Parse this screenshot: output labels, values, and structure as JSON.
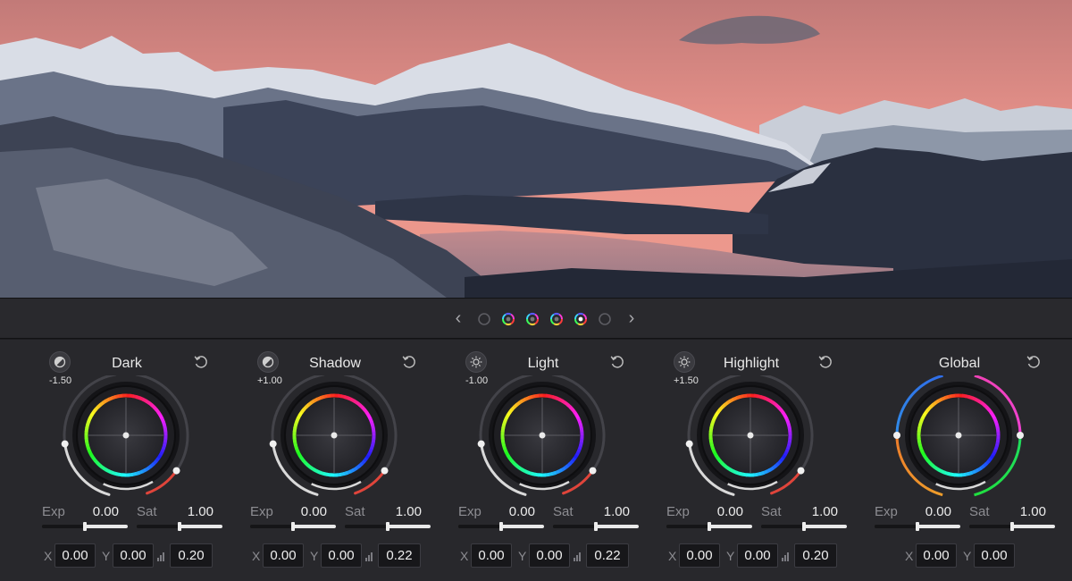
{
  "nav": {
    "prev_label": "‹",
    "next_label": "›",
    "dots": [
      {
        "state": "inactive"
      },
      {
        "state": "color"
      },
      {
        "state": "color"
      },
      {
        "state": "color"
      },
      {
        "state": "color-selected"
      },
      {
        "state": "inactive"
      }
    ]
  },
  "wheels": [
    {
      "title": "Dark",
      "mode_icon": "contrast-icon",
      "range_label": "-1.50",
      "exp": "0.00",
      "sat": "1.00",
      "x": "0.00",
      "y": "0.00",
      "gain": "0.20",
      "exp_level": 0.5,
      "sat_level": 0.5
    },
    {
      "title": "Shadow",
      "mode_icon": "contrast-icon",
      "range_label": "+1.00",
      "exp": "0.00",
      "sat": "1.00",
      "x": "0.00",
      "y": "0.00",
      "gain": "0.22",
      "exp_level": 0.5,
      "sat_level": 0.5
    },
    {
      "title": "Light",
      "mode_icon": "sun-icon",
      "range_label": "-1.00",
      "exp": "0.00",
      "sat": "1.00",
      "x": "0.00",
      "y": "0.00",
      "gain": "0.22",
      "exp_level": 0.5,
      "sat_level": 0.5
    },
    {
      "title": "Highlight",
      "mode_icon": "sun-icon",
      "range_label": "+1.50",
      "exp": "0.00",
      "sat": "1.00",
      "x": "0.00",
      "y": "0.00",
      "gain": "0.20",
      "exp_level": 0.5,
      "sat_level": 0.5
    },
    {
      "title": "Global",
      "mode_icon": "",
      "range_label": "",
      "exp": "0.00",
      "sat": "1.00",
      "x": "0.00",
      "y": "0.00",
      "gain": "",
      "exp_level": 0.5,
      "sat_level": 0.5
    }
  ],
  "labels": {
    "exp": "Exp",
    "sat": "Sat",
    "x": "X",
    "y": "Y"
  },
  "colors": {
    "panel": "#28282c",
    "field": "#17171a",
    "sky": "#e88a84",
    "accent_red": "#e0443a"
  }
}
